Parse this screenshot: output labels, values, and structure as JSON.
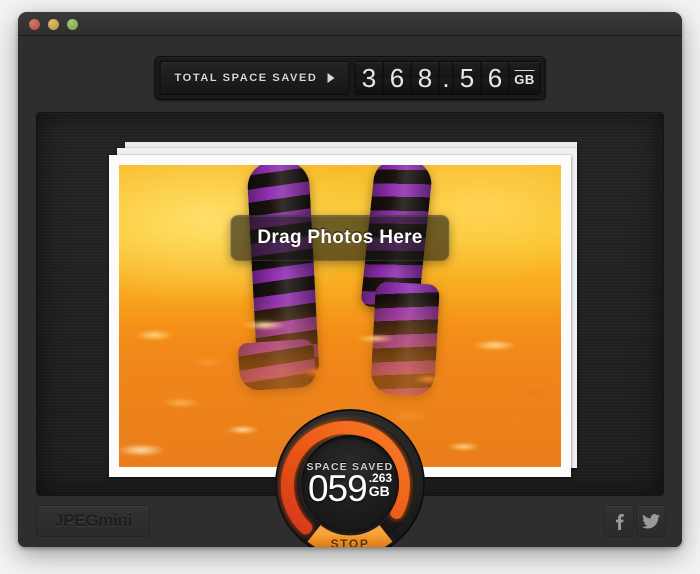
{
  "app": {
    "name": "JPEGmini",
    "logo_text": "JPEGmini"
  },
  "titlebar": {
    "close_label": "",
    "minimize_label": "",
    "zoom_label": ""
  },
  "counter": {
    "button_label": "TOTAL SPACE SAVED",
    "arrow_icon": "triangle-right-icon",
    "digits": [
      "3",
      "6",
      "8",
      ".",
      "5",
      "6"
    ],
    "value": "368.56",
    "unit": "GB"
  },
  "dropzone": {
    "drag_label": "Drag Photos Here"
  },
  "dial": {
    "label": "SPACE SAVED",
    "integer": "059",
    "decimal": ".263",
    "unit": "GB",
    "value": "059.263 GB",
    "stop_label": "STOP",
    "progress_percent": 72,
    "ring_color": "#e8521f",
    "ring_glow_color": "#ff7a2a",
    "track_color": "#2a2a2a",
    "stop_color": "#f0901f"
  },
  "footer": {
    "facebook_label": "f",
    "facebook_icon": "facebook-icon",
    "twitter_icon": "twitter-icon"
  },
  "colors": {
    "window_bg": "#2e2e2e",
    "panel_bg": "#212121",
    "accent_orange": "#f0901f",
    "accent_red": "#e8521f",
    "sock_purple": "#8f2fb0",
    "sock_dark": "#19120f"
  }
}
